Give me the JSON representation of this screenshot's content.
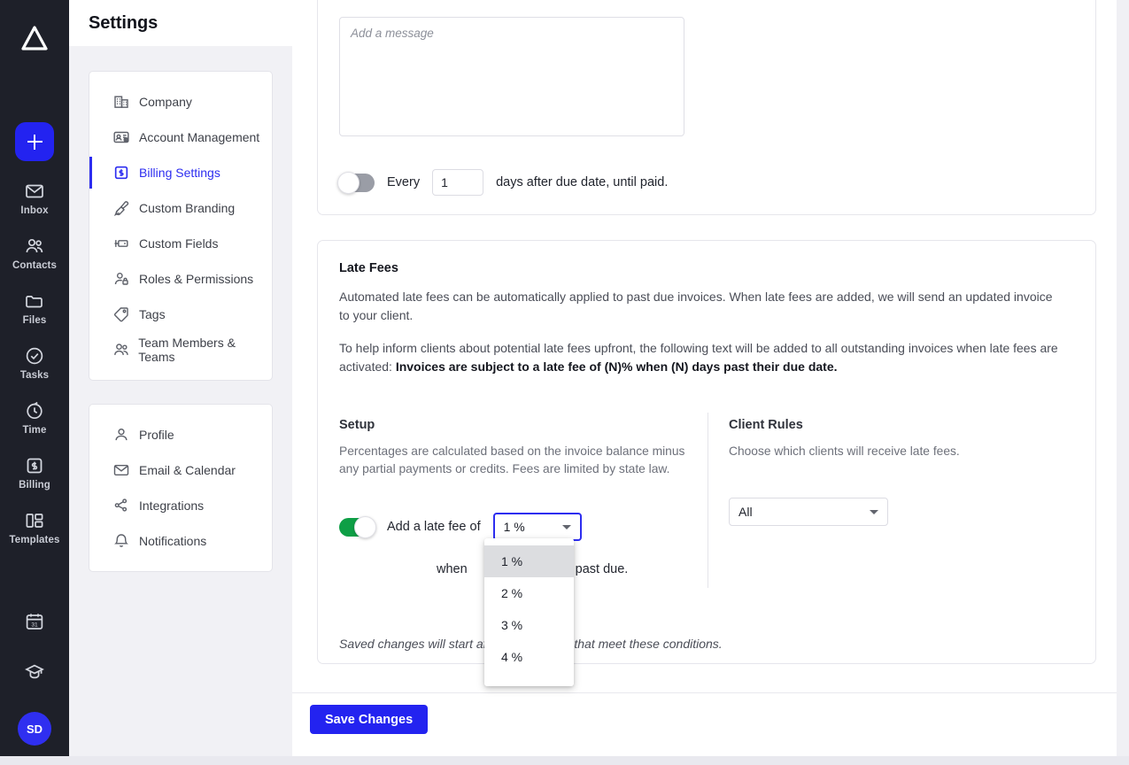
{
  "rail": {
    "logo_icon": "triangle-logo-icon",
    "add_button": {
      "icon": "plus-icon",
      "label": ""
    },
    "items": [
      {
        "label": "Inbox",
        "icon": "envelope-icon"
      },
      {
        "label": "Contacts",
        "icon": "contacts-icon"
      },
      {
        "label": "Files",
        "icon": "folder-icon"
      },
      {
        "label": "Tasks",
        "icon": "check-circle-icon"
      },
      {
        "label": "Time",
        "icon": "timer-icon"
      },
      {
        "label": "Billing",
        "icon": "dollar-card-icon"
      },
      {
        "label": "Templates",
        "icon": "templates-icon"
      }
    ],
    "bottom": [
      {
        "icon": "calendar-31-icon"
      },
      {
        "icon": "graduation-cap-icon"
      }
    ],
    "avatar_initials": "SD"
  },
  "settings": {
    "title": "Settings",
    "nav_primary": [
      {
        "label": "Company",
        "icon": "building-icon",
        "active": false
      },
      {
        "label": "Account Management",
        "icon": "id-card-gear-icon",
        "active": false
      },
      {
        "label": "Billing Settings",
        "icon": "dollar-card-icon",
        "active": true
      },
      {
        "label": "Custom Branding",
        "icon": "paintbrush-icon",
        "active": false
      },
      {
        "label": "Custom Fields",
        "icon": "custom-fields-icon",
        "active": false
      },
      {
        "label": "Roles & Permissions",
        "icon": "user-lock-icon",
        "active": false
      },
      {
        "label": "Tags",
        "icon": "tag-icon",
        "active": false
      },
      {
        "label": "Team Members & Teams",
        "icon": "users-icon",
        "active": false
      }
    ],
    "nav_secondary": [
      {
        "label": "Profile",
        "icon": "user-icon"
      },
      {
        "label": "Email & Calendar",
        "icon": "envelope-icon"
      },
      {
        "label": "Integrations",
        "icon": "integrations-icon"
      },
      {
        "label": "Notifications",
        "icon": "bell-icon"
      }
    ]
  },
  "reminders_card": {
    "message_placeholder": "Add a message",
    "message_value": "",
    "repeat_toggle_state": "off",
    "every_label": "Every",
    "days_value": "1",
    "days_suffix": "days after due date, until paid."
  },
  "late_fees": {
    "title": "Late Fees",
    "paragraph_1": "Automated late fees can be automatically applied to past due invoices. When late fees are added, we will send an updated invoice to your client.",
    "paragraph_2_prefix": "To help inform clients about potential late fees upfront, the following text will be added to all outstanding invoices when late fees are activated: ",
    "paragraph_2_bold": "Invoices are subject to a late fee of (N)% when (N) days past their due date.",
    "setup": {
      "heading": "Setup",
      "description": "Percentages are calculated based on the invoice balance minus any partial payments or credits. Fees are limited by state law.",
      "toggle_state": "on",
      "fee_label": "Add a late fee of",
      "fee_value": "1 %",
      "when_prefix": "when",
      "when_suffix": "past due."
    },
    "client_rules": {
      "heading": "Client Rules",
      "description": "Choose which clients will receive late fees.",
      "value": "All"
    },
    "note": "Saved changes will start          affect all invoices that meet these conditions."
  },
  "fee_dropdown": {
    "open": true,
    "selected_index": 0,
    "options": [
      "1 %",
      "2 %",
      "3 %",
      "4 %"
    ]
  },
  "footer": {
    "save_label": "Save Changes"
  },
  "colors": {
    "accent_blue": "#2323f0",
    "toggle_on_green": "#0e9f46",
    "toggle_off_gray": "#9a9da6",
    "rail_bg": "#1e2029",
    "page_bg": "#f1f1f5"
  }
}
